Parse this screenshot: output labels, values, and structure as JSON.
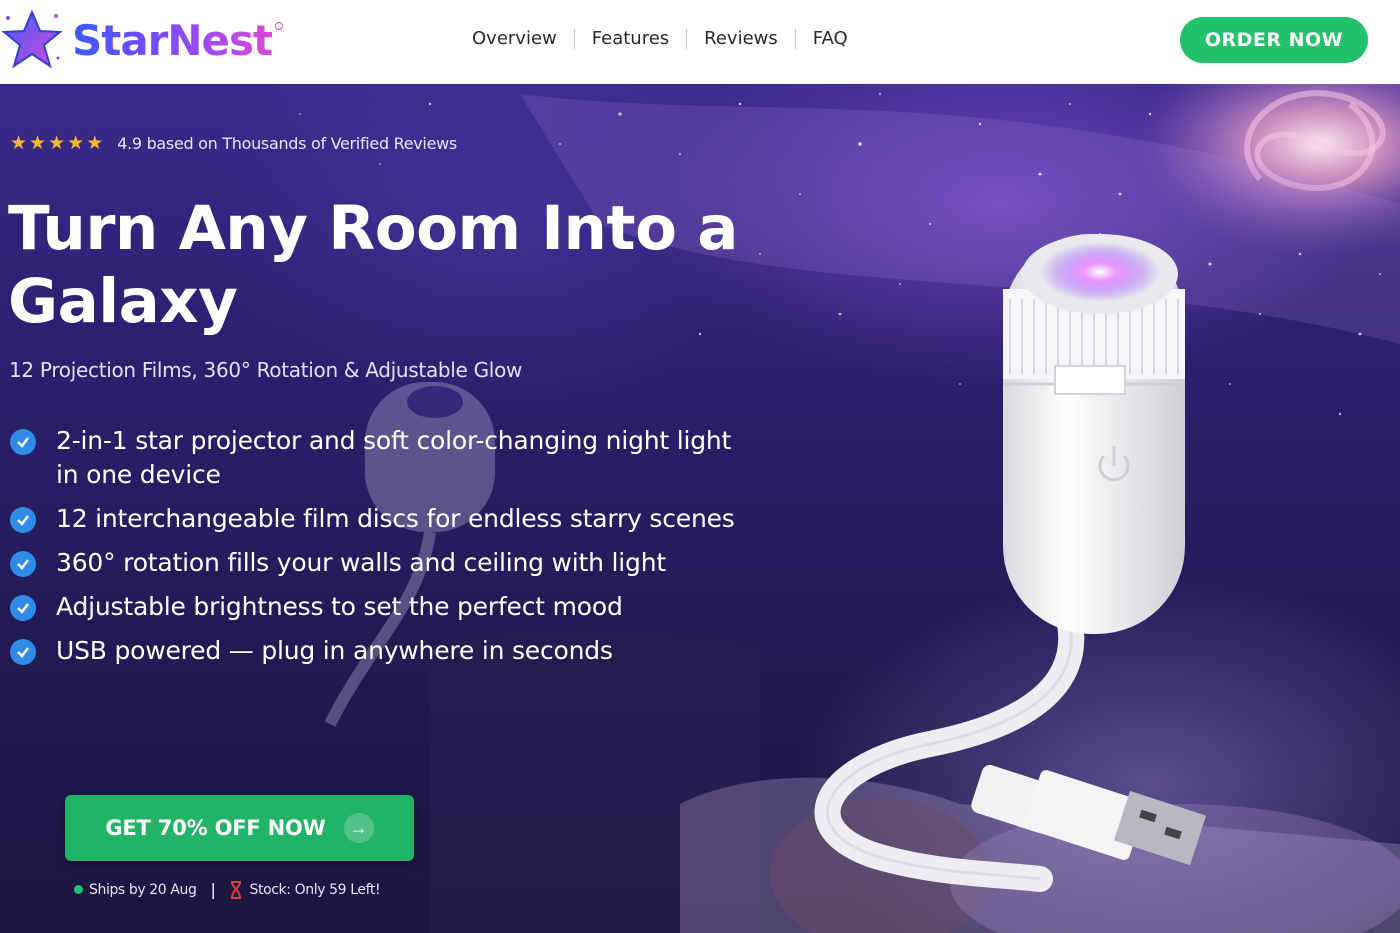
{
  "header": {
    "logo_text": "StarNest",
    "nav": [
      {
        "label": "Overview"
      },
      {
        "label": "Features"
      },
      {
        "label": "Reviews"
      },
      {
        "label": "FAQ"
      }
    ],
    "order_label": "ORDER NOW"
  },
  "hero": {
    "rating": {
      "stars": 5,
      "text": "4.9 based on Thousands of Verified Reviews"
    },
    "headline": "Turn Any Room Into a Galaxy",
    "subheadline": "12 Projection Films, 360° Rotation & Adjustable Glow",
    "features": [
      {
        "text": "2-in-1 star projector and soft color-changing night light in one device"
      },
      {
        "text": "12 interchangeable film discs for endless starry scenes"
      },
      {
        "text": "360° rotation fills your walls and ceiling with light"
      },
      {
        "text": "Adjustable brightness to set the perfect mood"
      },
      {
        "text": "USB powered — plug in anywhere in seconds"
      }
    ],
    "cta_label": "GET 70% OFF NOW",
    "shipping": "Ships by 20 Aug",
    "stock": "Stock: Only 59 Left!"
  },
  "colors": {
    "accent_green": "#22c16b",
    "check_blue": "#2f8be6",
    "star_gold": "#f7b733"
  },
  "icons": [
    "star-logo-icon",
    "star-icon",
    "check-icon",
    "arrow-right-icon",
    "hourglass-icon",
    "power-icon"
  ]
}
